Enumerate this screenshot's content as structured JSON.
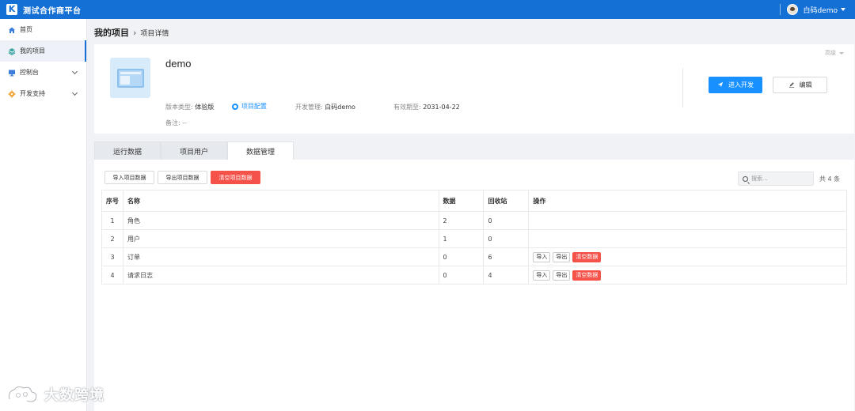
{
  "app": {
    "title": "测试合作商平台"
  },
  "user": {
    "name": "白码demo"
  },
  "sidebar": {
    "items": [
      {
        "label": "首页",
        "icon": "home-icon"
      },
      {
        "label": "我的项目",
        "icon": "layers-icon"
      },
      {
        "label": "控制台",
        "icon": "monitor-icon"
      },
      {
        "label": "开发支持",
        "icon": "gear-icon"
      }
    ]
  },
  "breadcrumb": {
    "root": "我的项目",
    "separator": "›",
    "current": "项目详情"
  },
  "project": {
    "name": "demo",
    "version_key": "版本类型:",
    "version_value": "体验版",
    "config_link": "项目配置",
    "dev_key": "开发管理:",
    "dev_value": "白码demo",
    "expiry_key": "有效期至:",
    "expiry_value": "2031-04-22",
    "remark_key": "备注:",
    "remark_value": "--",
    "advanced": "高级",
    "enter_dev": "进入开发",
    "edit": "编辑"
  },
  "tabs": [
    {
      "label": "运行数据"
    },
    {
      "label": "项目用户"
    },
    {
      "label": "数据管理"
    }
  ],
  "toolbar": {
    "import": "导入项目数据",
    "export": "导出项目数据",
    "clear": "清空项目数据",
    "search_placeholder": "搜索...",
    "total": "共 4 条"
  },
  "table": {
    "headers": [
      "序号",
      "名称",
      "数据",
      "回收站",
      "操作"
    ],
    "rows": [
      {
        "idx": "1",
        "name": "角色",
        "data": "2",
        "trash": "0"
      },
      {
        "idx": "2",
        "name": "用户",
        "data": "1",
        "trash": "0"
      },
      {
        "idx": "3",
        "name": "订单",
        "data": "0",
        "trash": "6"
      },
      {
        "idx": "4",
        "name": "请求日志",
        "data": "0",
        "trash": "4"
      }
    ],
    "op_import": "导入",
    "op_export": "导出",
    "op_clear": "清空数据"
  },
  "watermark": {
    "text": "大数跨境"
  },
  "colors": {
    "primary": "#1570d6",
    "link": "#1890ff",
    "danger": "#f5524a"
  }
}
